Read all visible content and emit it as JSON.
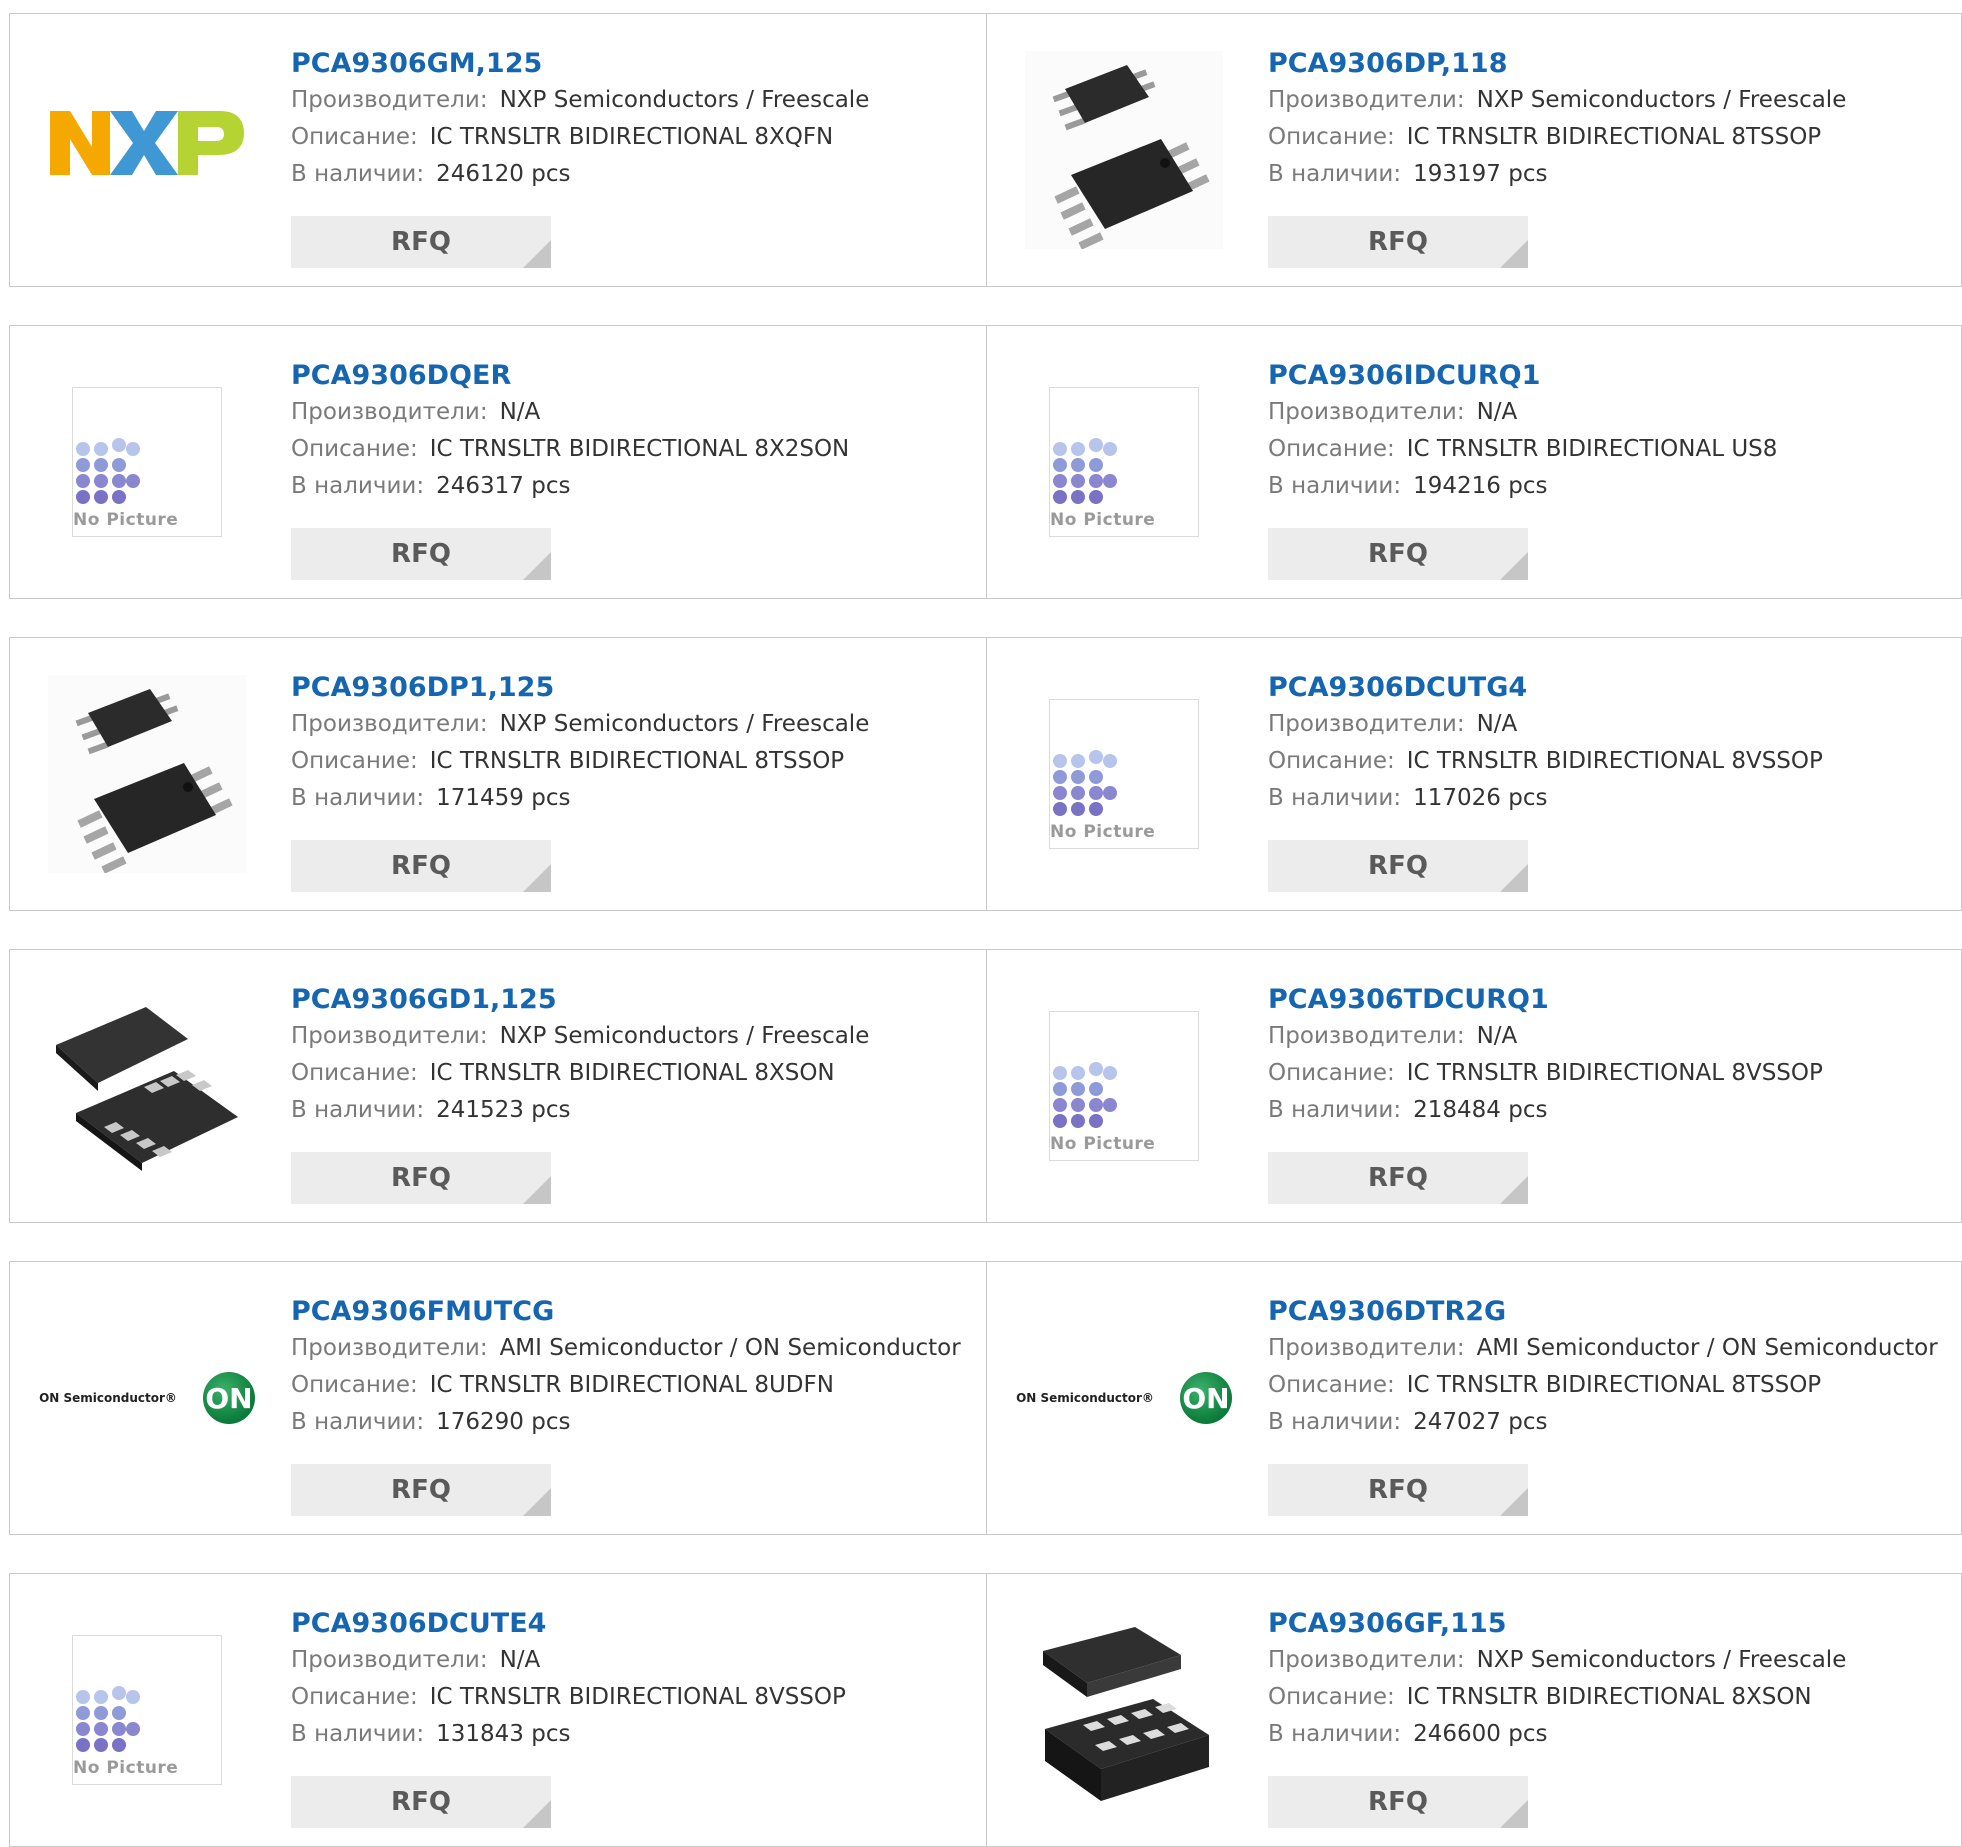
{
  "labels": {
    "manufacturer": "Производители:",
    "description": "Описание:",
    "stock": "В наличии:",
    "rfq": "RFQ",
    "no_picture": "No Picture"
  },
  "colors": {
    "title_link": "#1565b0",
    "label_gray": "#7a7a7a",
    "rfq_bg": "#ececec"
  },
  "products": [
    {
      "part": "PCA9306GM,125",
      "manufacturer": "NXP Semiconductors / Freescale",
      "description": "IC TRNSLTR BIDIRECTIONAL 8XQFN",
      "stock": "246120 pcs",
      "image": "nxp-logo"
    },
    {
      "part": "PCA9306DP,118",
      "manufacturer": "NXP Semiconductors / Freescale",
      "description": "IC TRNSLTR BIDIRECTIONAL 8TSSOP",
      "stock": "193197 pcs",
      "image": "tssop-chip"
    },
    {
      "part": "PCA9306DQER",
      "manufacturer": "N/A",
      "description": "IC TRNSLTR BIDIRECTIONAL 8X2SON",
      "stock": "246317 pcs",
      "image": "no-picture"
    },
    {
      "part": "PCA9306IDCURQ1",
      "manufacturer": "N/A",
      "description": "IC TRNSLTR BIDIRECTIONAL US8",
      "stock": "194216 pcs",
      "image": "no-picture"
    },
    {
      "part": "PCA9306DP1,125",
      "manufacturer": "NXP Semiconductors / Freescale",
      "description": "IC TRNSLTR BIDIRECTIONAL 8TSSOP",
      "stock": "171459 pcs",
      "image": "tssop-chip"
    },
    {
      "part": "PCA9306DCUTG4",
      "manufacturer": "N/A",
      "description": "IC TRNSLTR BIDIRECTIONAL 8VSSOP",
      "stock": "117026 pcs",
      "image": "no-picture"
    },
    {
      "part": "PCA9306GD1,125",
      "manufacturer": "NXP Semiconductors / Freescale",
      "description": "IC TRNSLTR BIDIRECTIONAL 8XSON",
      "stock": "241523 pcs",
      "image": "xson-chip"
    },
    {
      "part": "PCA9306TDCURQ1",
      "manufacturer": "N/A",
      "description": "IC TRNSLTR BIDIRECTIONAL 8VSSOP",
      "stock": "218484 pcs",
      "image": "no-picture"
    },
    {
      "part": "PCA9306FMUTCG",
      "manufacturer": "AMI Semiconductor / ON Semiconductor",
      "description": "IC TRNSLTR BIDIRECTIONAL 8UDFN",
      "stock": "176290 pcs",
      "image": "on-semi-logo"
    },
    {
      "part": "PCA9306DTR2G",
      "manufacturer": "AMI Semiconductor / ON Semiconductor",
      "description": "IC TRNSLTR BIDIRECTIONAL 8TSSOP",
      "stock": "247027 pcs",
      "image": "on-semi-logo"
    },
    {
      "part": "PCA9306DCUTE4",
      "manufacturer": "N/A",
      "description": "IC TRNSLTR BIDIRECTIONAL 8VSSOP",
      "stock": "131843 pcs",
      "image": "no-picture"
    },
    {
      "part": "PCA9306GF,115",
      "manufacturer": "NXP Semiconductors / Freescale",
      "description": "IC TRNSLTR BIDIRECTIONAL 8XSON",
      "stock": "246600 pcs",
      "image": "xson-chip-large"
    }
  ],
  "logos": {
    "on_semi_text": "ON Semiconductor®",
    "on_semi_badge": "ON"
  }
}
